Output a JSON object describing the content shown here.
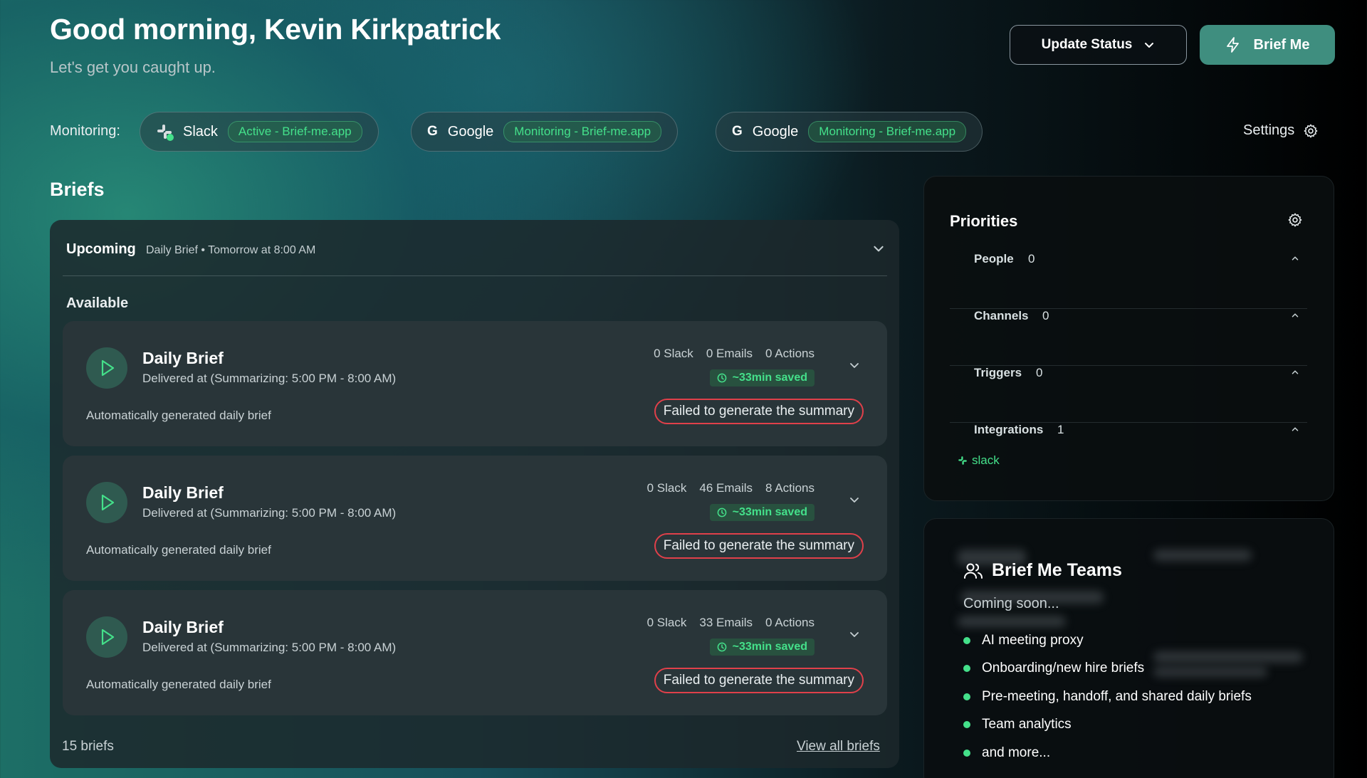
{
  "header": {
    "greeting": "Good morning, Kevin Kirkpatrick",
    "subtitle": "Let's get you caught up.",
    "update_status_label": "Update Status",
    "brief_me_label": "Brief Me"
  },
  "monitoring": {
    "label": "Monitoring:",
    "chips": [
      {
        "icon": "slack-icon",
        "name": "Slack",
        "status": "Active - Brief-me.app"
      },
      {
        "icon": "G",
        "name": "Google",
        "status": "Monitoring - Brief-me.app"
      },
      {
        "icon": "G",
        "name": "Google",
        "status": "Monitoring - Brief-me.app"
      }
    ],
    "settings_label": "Settings"
  },
  "briefs": {
    "heading": "Briefs",
    "upcoming_label": "Upcoming",
    "upcoming_meta": "Daily Brief • Tomorrow at 8:00 AM",
    "available_label": "Available",
    "cards": [
      {
        "title": "Daily Brief",
        "delivered": "Delivered at (Summarizing: 5:00 PM - 8:00 AM)",
        "description": "Automatically generated daily brief",
        "slack": "0 Slack",
        "emails": "0 Emails",
        "actions": "0 Actions",
        "saved": "~33min saved",
        "error": "Failed to generate the summary"
      },
      {
        "title": "Daily Brief",
        "delivered": "Delivered at (Summarizing: 5:00 PM - 8:00 AM)",
        "description": "Automatically generated daily brief",
        "slack": "0 Slack",
        "emails": "46 Emails",
        "actions": "8 Actions",
        "saved": "~33min saved",
        "error": "Failed to generate the summary"
      },
      {
        "title": "Daily Brief",
        "delivered": "Delivered at (Summarizing: 5:00 PM - 8:00 AM)",
        "description": "Automatically generated daily brief",
        "slack": "0 Slack",
        "emails": "33 Emails",
        "actions": "0 Actions",
        "saved": "~33min saved",
        "error": "Failed to generate the summary"
      }
    ],
    "count_label": "15 briefs",
    "view_all_label": "View all briefs"
  },
  "priorities": {
    "title": "Priorities",
    "rows": [
      {
        "label": "People",
        "count": "0"
      },
      {
        "label": "Channels",
        "count": "0"
      },
      {
        "label": "Triggers",
        "count": "0"
      },
      {
        "label": "Integrations",
        "count": "1"
      }
    ],
    "integration_item": "slack"
  },
  "teams": {
    "title": "Brief Me Teams",
    "coming_soon": "Coming soon...",
    "features": [
      "AI meeting proxy",
      "Onboarding/new hire briefs",
      "Pre-meeting, handoff, and shared daily briefs",
      "Team analytics",
      "and more..."
    ]
  },
  "colors": {
    "accent_green": "#44e08a",
    "brief_button": "#3f8e7f",
    "error_red": "#e0404a"
  }
}
